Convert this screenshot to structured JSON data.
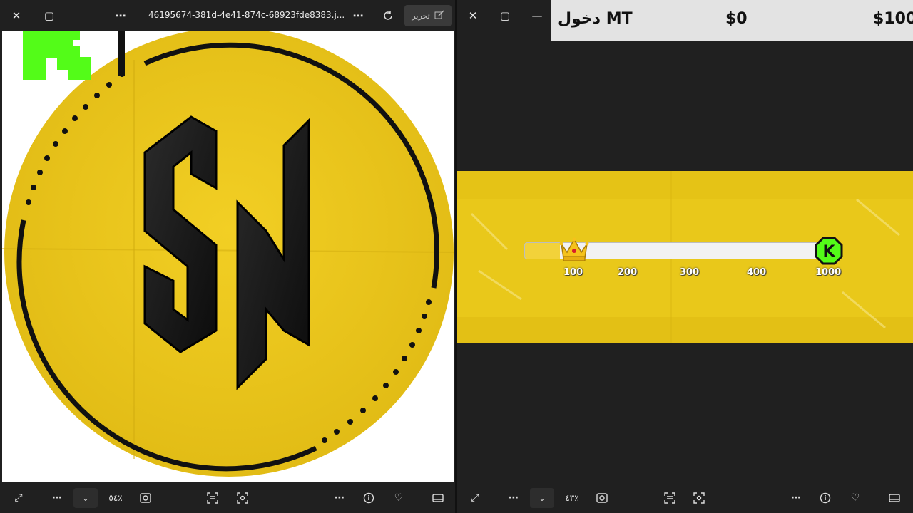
{
  "left_window": {
    "filename": "46195674-381d-4e41-874c-68923fde8383.j...",
    "edit_label": "تحرير",
    "zoom": "٥٤٪",
    "logo_text": "SN",
    "overlay_letter": "K"
  },
  "right_window": {
    "zoom": "٤٣٪",
    "price_bar": {
      "login_label": "دخول MT",
      "price_low": "$0",
      "price_high": "$100"
    },
    "progress": {
      "fill_fraction": 0.12,
      "ticks": [
        "100",
        "200",
        "300",
        "400",
        "1000"
      ],
      "end_badge": "K"
    }
  },
  "colors": {
    "accent_yellow": "#e9c81a",
    "k_green": "#53fc18",
    "dark_bg": "#202020"
  }
}
